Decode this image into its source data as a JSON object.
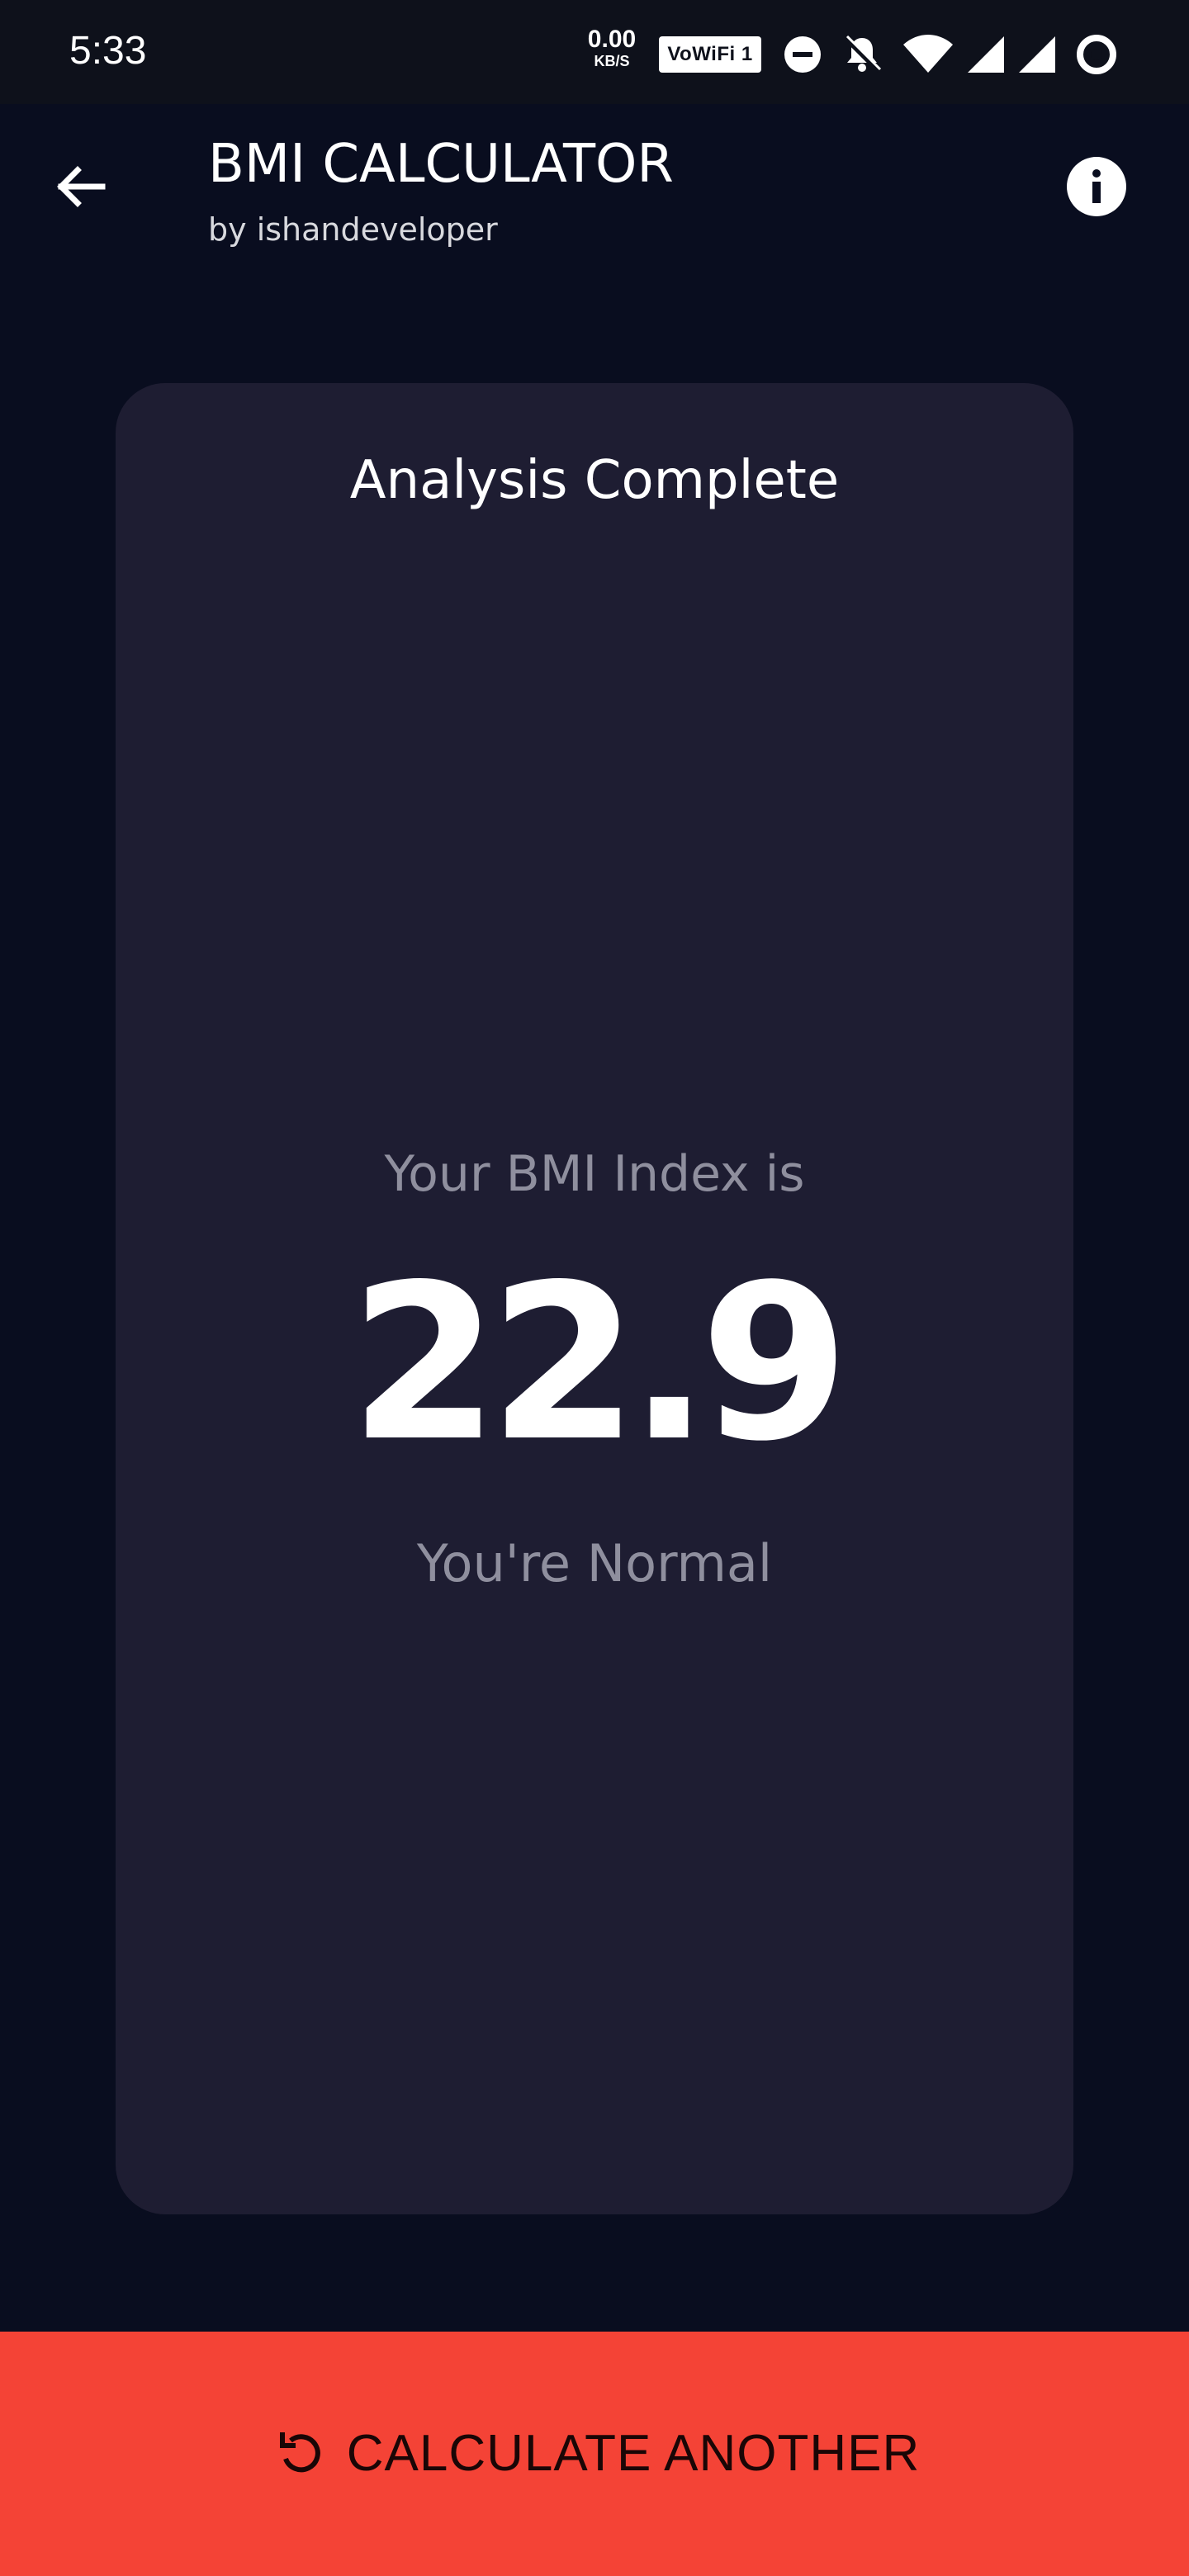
{
  "status_bar": {
    "time": "5:33",
    "net_speed_value": "0.00",
    "net_speed_unit": "KB/S",
    "wifi_badge": "VoWiFi 1",
    "icons": [
      "dnd-icon",
      "bell-muted-icon",
      "wifi-icon",
      "signal-icon",
      "signal-icon",
      "battery-icon"
    ]
  },
  "app_bar": {
    "title": "BMI CALCULATOR",
    "subtitle": "by ishandeveloper",
    "back_icon": "arrow-back-icon",
    "info_icon": "info-icon"
  },
  "result": {
    "heading": "Analysis Complete",
    "label": "Your BMI Index is",
    "value": "22.9",
    "status": "You're Normal"
  },
  "action": {
    "label": "CALCULATE ANOTHER",
    "icon": "refresh-icon"
  },
  "colors": {
    "background": "#090d1f",
    "card": "#1e1d32",
    "accent": "#f44336",
    "muted_text": "#8f8f9e"
  }
}
